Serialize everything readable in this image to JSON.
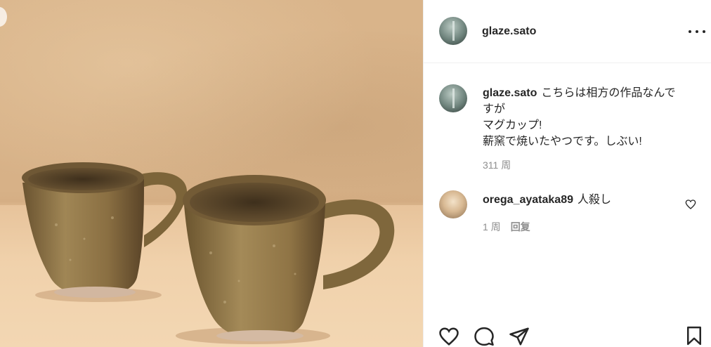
{
  "post": {
    "author": "glaze.sato",
    "caption": {
      "username": "glaze.sato",
      "lines": [
        "こちらは相方の作品なんで",
        "すが",
        "マグカップ!",
        "薪窯で焼いたやつです。しぶい!"
      ]
    },
    "timestamp": "311 周"
  },
  "comments": [
    {
      "username": "orega_ayataka89",
      "text": "人殺し",
      "timestamp": "1 周",
      "reply_label": "回复"
    }
  ],
  "icons": {
    "more": "more-horizontal-icon",
    "comment_like": "heart-outline-icon",
    "like": "heart-icon",
    "comment": "comment-icon",
    "share": "send-icon",
    "save": "bookmark-icon"
  },
  "colors": {
    "text": "#262626",
    "secondary_text": "#8e8e8e",
    "divider": "#efefef"
  }
}
